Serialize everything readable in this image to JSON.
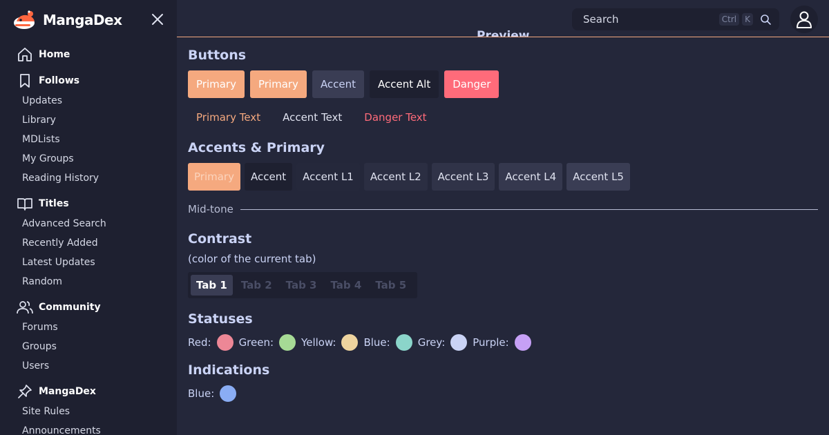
{
  "brand": {
    "name": "MangaDex"
  },
  "sidebar": {
    "home": "Home",
    "follows": "Follows",
    "follows_items": [
      "Updates",
      "Library",
      "MDLists",
      "My Groups",
      "Reading History"
    ],
    "titles": "Titles",
    "titles_items": [
      "Advanced Search",
      "Recently Added",
      "Latest Updates",
      "Random"
    ],
    "community": "Community",
    "community_items": [
      "Forums",
      "Groups",
      "Users"
    ],
    "mangadex": "MangaDex",
    "mangadex_items": [
      "Site Rules",
      "Announcements"
    ]
  },
  "header": {
    "search_placeholder": "Search",
    "kbd_ctrl": "Ctrl",
    "kbd_k": "K",
    "peek_title": "Preview"
  },
  "sections": {
    "buttons_title": "Buttons",
    "buttons": [
      "Primary",
      "Primary",
      "Accent",
      "Accent Alt",
      "Danger"
    ],
    "text_buttons": [
      "Primary Text",
      "Accent Text",
      "Danger Text"
    ],
    "accents_title": "Accents & Primary",
    "accents": [
      "Primary",
      "Accent",
      "Accent L1",
      "Accent L2",
      "Accent L3",
      "Accent L4",
      "Accent L5"
    ],
    "midtone": "Mid-tone",
    "contrast_title": "Contrast",
    "contrast_sub": "(color of the current tab)",
    "tabs": [
      "Tab 1",
      "Tab 2",
      "Tab 3",
      "Tab 4",
      "Tab 5"
    ],
    "statuses_title": "Statuses",
    "statuses": [
      "Red:",
      "Green:",
      "Yellow:",
      "Blue:",
      "Grey:",
      "Purple:"
    ],
    "indications_title": "Indications",
    "indications": [
      "Blue:"
    ]
  },
  "colors": {
    "primary": "#f5a97f",
    "danger": "#ff6b7a",
    "status_red": "#ed8796",
    "status_green": "#a6da95",
    "status_yellow": "#eed49f",
    "status_blue": "#8bd5ca",
    "status_grey": "#cad3f5",
    "status_purple": "#c6a0f6",
    "indication_blue": "#8aadf4"
  }
}
